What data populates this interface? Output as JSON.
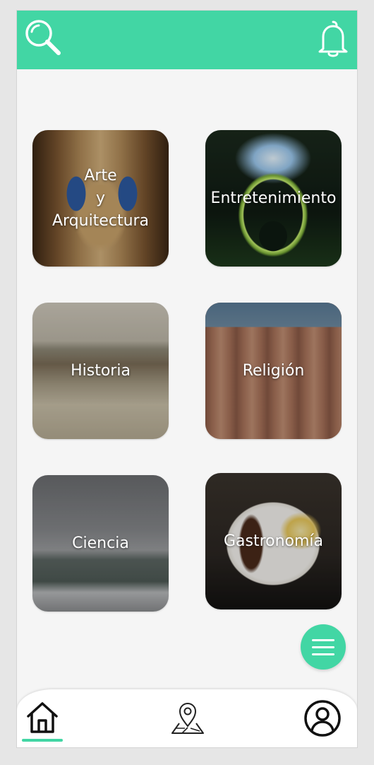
{
  "topbar": {
    "left_icon": "search-icon",
    "right_icon": "bell-icon",
    "color": "#42d6a4"
  },
  "categories": [
    {
      "label": "Arte\ny\nArquitectura"
    },
    {
      "label": "Entretenimiento"
    },
    {
      "label": "Historia"
    },
    {
      "label": "Religión"
    },
    {
      "label": "Ciencia"
    },
    {
      "label": "Gastronomía"
    }
  ],
  "fab": {
    "icon": "menu-icon"
  },
  "bottom_nav": {
    "items": [
      {
        "icon": "home-icon",
        "active": true
      },
      {
        "icon": "map-pin-icon",
        "active": false
      },
      {
        "icon": "user-profile-icon",
        "active": false
      }
    ]
  }
}
